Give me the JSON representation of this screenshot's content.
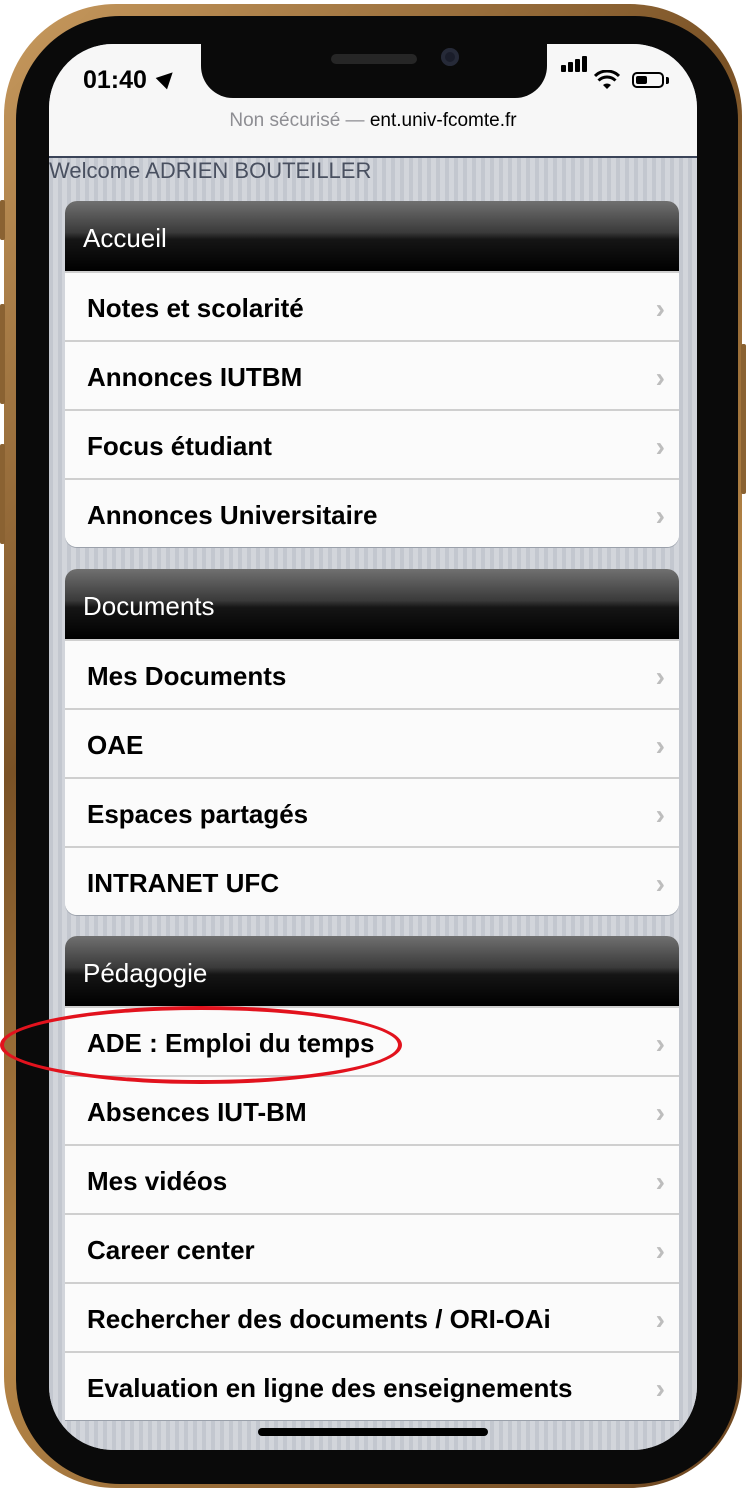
{
  "status_bar": {
    "time": "01:40"
  },
  "browser": {
    "insecure_label": "Non sécurisé",
    "separator": " — ",
    "domain": "ent.univ-fcomte.fr"
  },
  "welcome_text": "Welcome ADRIEN BOUTEILLER",
  "sections": [
    {
      "title": "Accueil",
      "items": [
        "Notes et scolarité",
        "Annonces IUTBM",
        "Focus étudiant",
        "Annonces Universitaire"
      ]
    },
    {
      "title": "Documents",
      "items": [
        "Mes Documents",
        "OAE",
        "Espaces partagés",
        "INTRANET UFC"
      ]
    },
    {
      "title": "Pédagogie",
      "items": [
        "ADE : Emploi du temps",
        "Absences IUT-BM",
        "Mes vidéos",
        "Career center",
        "Rechercher des documents / ORI-OAi",
        "Evaluation en ligne des enseignements"
      ]
    }
  ],
  "chevron_glyph": "›",
  "annotation": {
    "highlighted_item": "ADE : Emploi du temps",
    "color": "#e2121d"
  },
  "colors": {
    "section_header": "#000000",
    "frame": "#b78748"
  }
}
